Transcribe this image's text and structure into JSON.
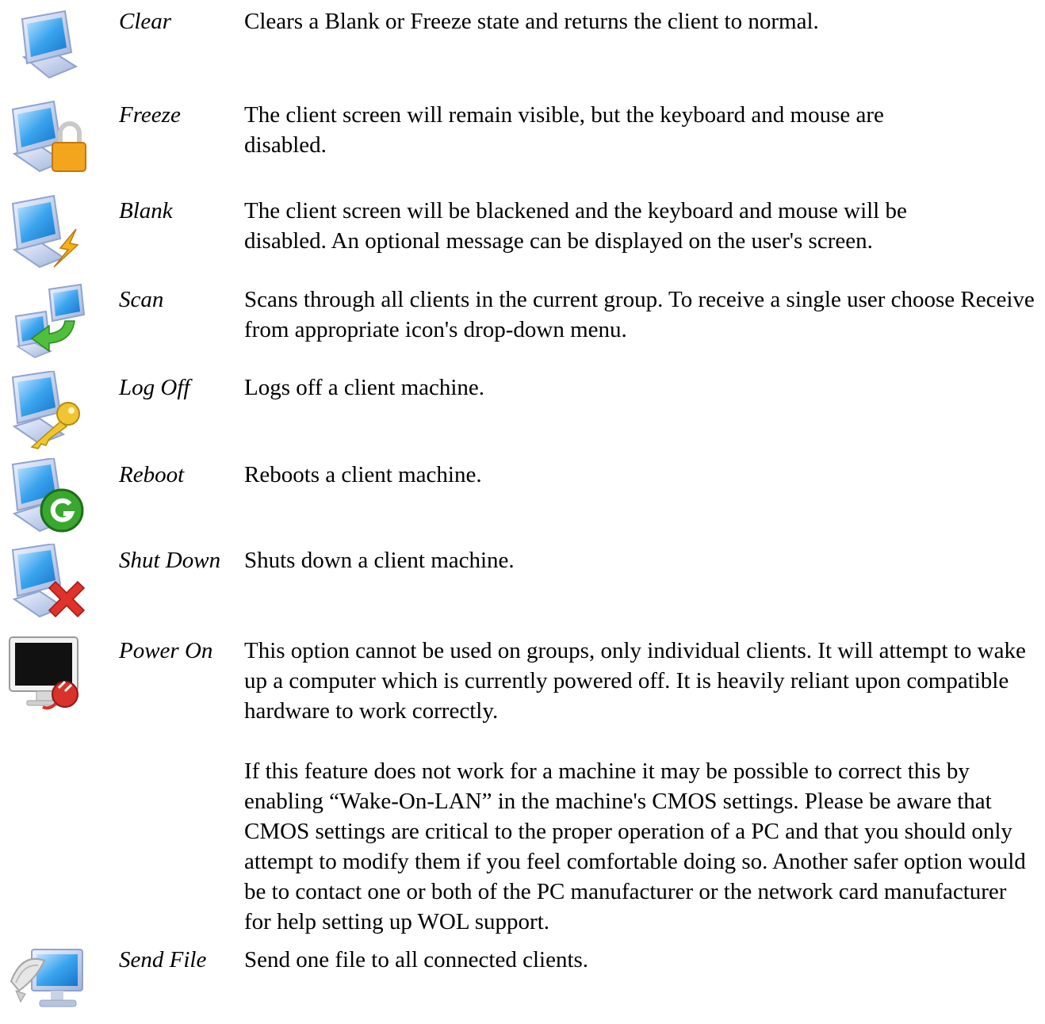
{
  "entries": [
    {
      "term": "Clear",
      "icon": "monitor-clear-icon",
      "description": [
        "Clears a Blank or Freeze state and returns the client to normal."
      ]
    },
    {
      "term": "Freeze",
      "icon": "monitor-lock-icon",
      "description": [
        "The client screen will remain visible, but the keyboard and mouse are disabled."
      ]
    },
    {
      "term": "Blank",
      "icon": "monitor-lightning-icon",
      "description": [
        "The client screen will be blackened and the keyboard and mouse will be disabled. An optional message can be displayed on the user's screen."
      ]
    },
    {
      "term": "Scan",
      "icon": "monitors-scan-arrow-icon",
      "description": [
        "Scans through all clients in the current group. To receive a single user choose Receive from appropriate icon's drop-down menu."
      ]
    },
    {
      "term": "Log Off",
      "icon": "monitor-key-icon",
      "description": [
        "Logs off a client machine."
      ]
    },
    {
      "term": "Reboot",
      "icon": "monitor-reboot-icon",
      "description": [
        "Reboots a client machine."
      ]
    },
    {
      "term": "Shut Down",
      "icon": "monitor-shutdown-x-icon",
      "description": [
        "Shuts down a client machine."
      ]
    },
    {
      "term": "Power On",
      "icon": "monitor-power-plug-icon",
      "description": [
        "This option cannot be used on groups, only individual clients. It will attempt to wake up a computer which is currently powered off. It is heavily reliant upon compatible hardware to work correctly.",
        "If this feature does not work for a machine it may be possible to correct this by enabling “Wake-On-LAN” in the machine's CMOS settings. Please be aware that CMOS settings are critical to the proper operation of a PC and that you should only attempt to modify them if you feel comfortable doing so. Another safer option would be to contact one or both of the PC manufacturer or the network card manufacturer for help setting up WOL support."
      ]
    },
    {
      "term": "Send File",
      "icon": "monitor-send-file-icon",
      "description": [
        "Send one file to all connected clients."
      ]
    }
  ],
  "colors": {
    "screen_blue": "#3aa4ee",
    "monitor_frame": "#c7d6f2",
    "lock_orange": "#f3a51e",
    "key_yellow": "#f0c531",
    "reboot_green": "#3aa72f",
    "shutdown_red": "#e0312b",
    "power_red": "#d8322a"
  }
}
